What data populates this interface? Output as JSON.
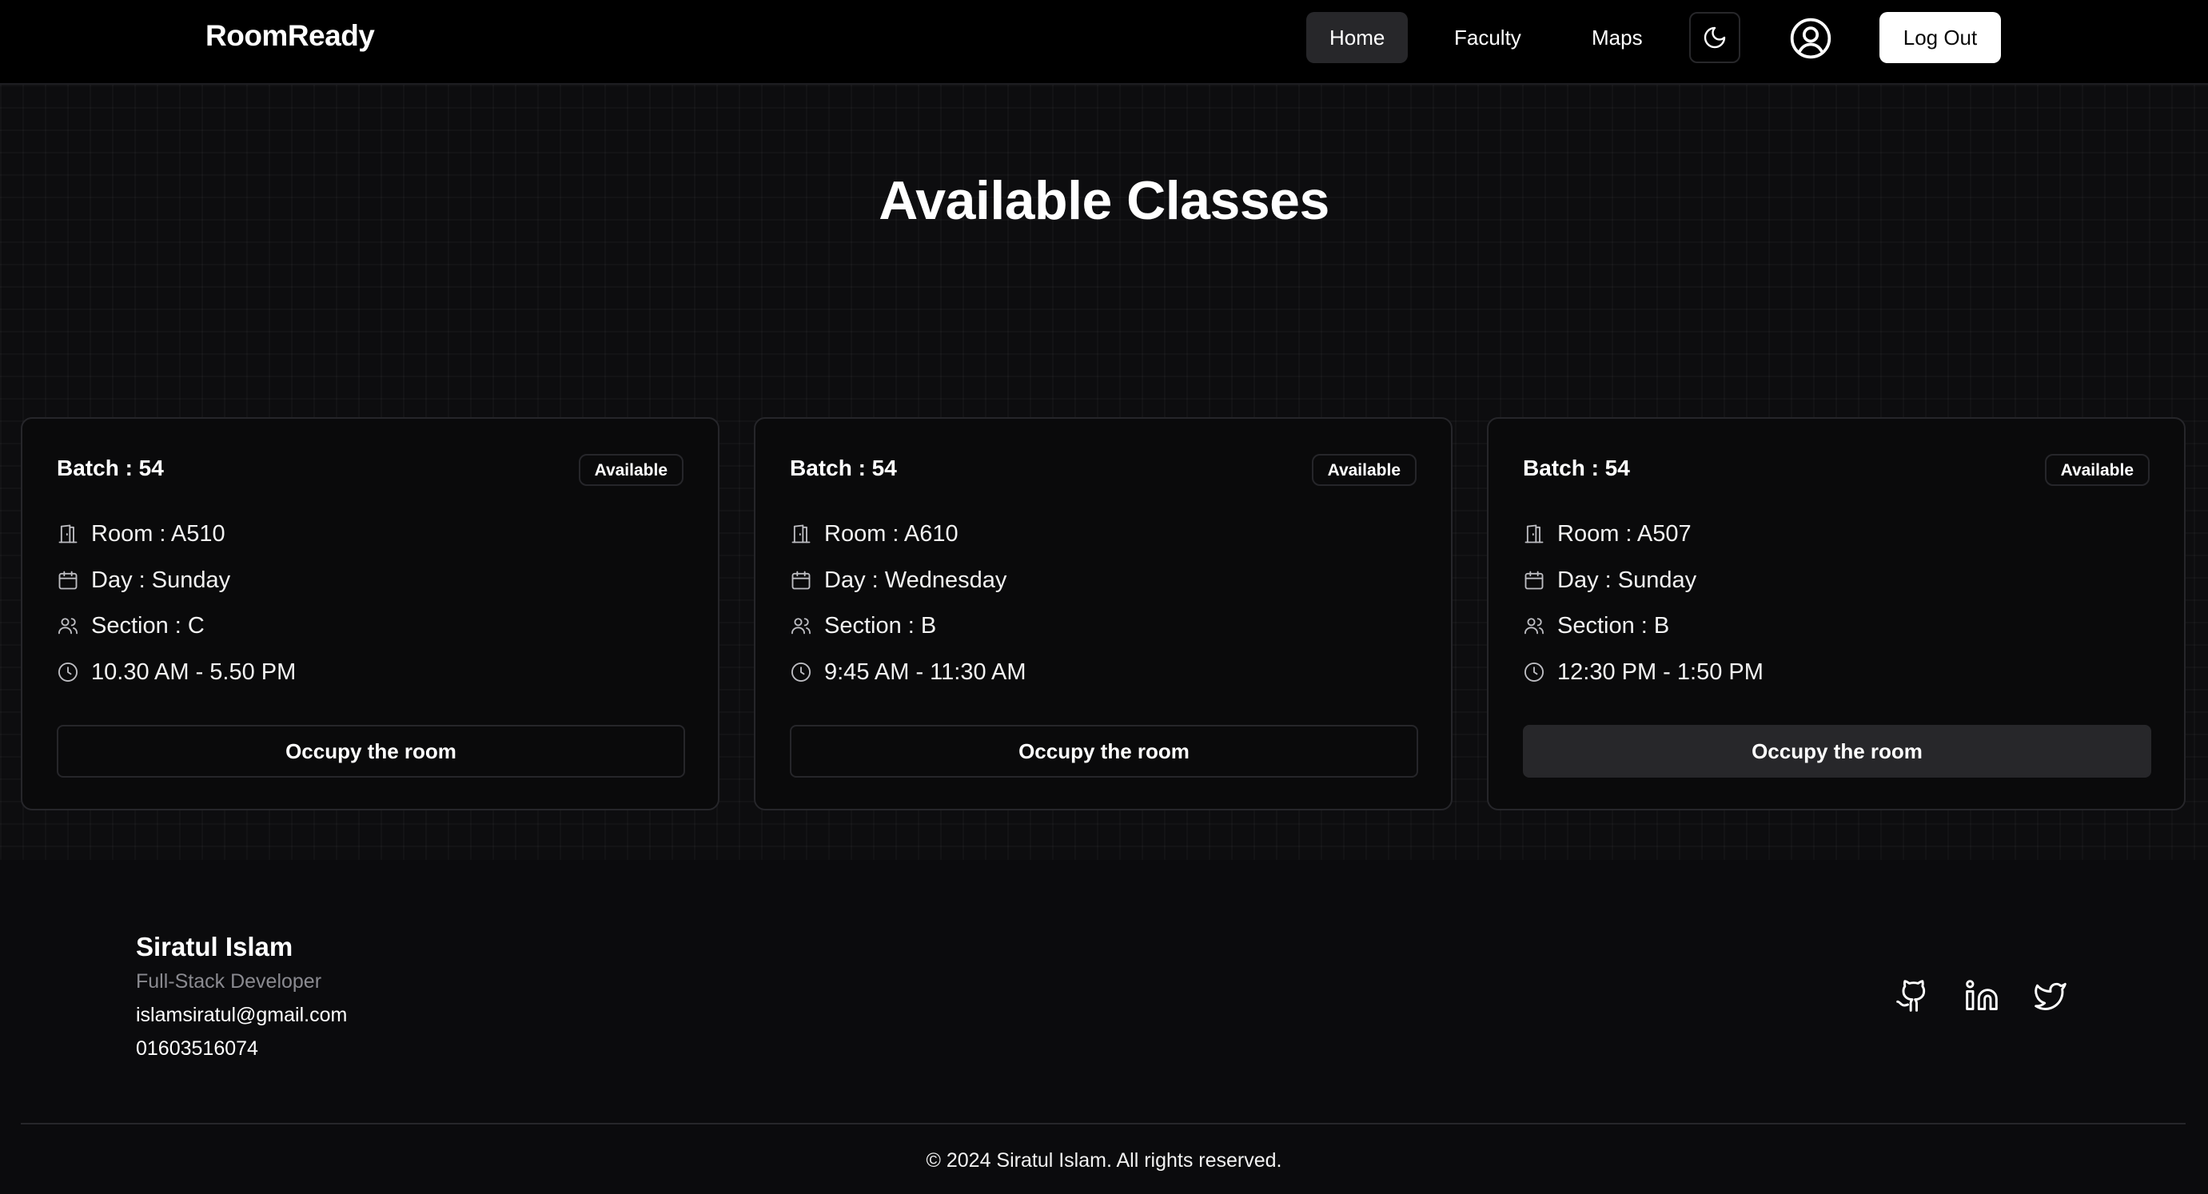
{
  "nav": {
    "brand": "RoomReady",
    "links": [
      {
        "label": "Home",
        "active": true
      },
      {
        "label": "Faculty",
        "active": false
      },
      {
        "label": "Maps",
        "active": false
      }
    ],
    "theme_toggle_icon": "moon-icon",
    "profile_icon": "user-circle-icon",
    "logout_label": "Log Out"
  },
  "page": {
    "title": "Available Classes"
  },
  "cards": [
    {
      "batch": "Batch : 54",
      "status": "Available",
      "room": "Room : A510",
      "day": "Day : Sunday",
      "section": "Section : C",
      "time": "10.30 AM - 5.50 PM",
      "action": "Occupy the room"
    },
    {
      "batch": "Batch : 54",
      "status": "Available",
      "room": "Room : A610",
      "day": "Day : Wednesday",
      "section": "Section : B",
      "time": "9:45 AM - 11:30 AM",
      "action": "Occupy the room"
    },
    {
      "batch": "Batch : 54",
      "status": "Available",
      "room": "Room : A507",
      "day": "Day : Sunday",
      "section": "Section : B",
      "time": "12:30 PM - 1:50 PM",
      "action": "Occupy the room"
    }
  ],
  "footer": {
    "name": "Siratul Islam",
    "role": "Full-Stack Developer",
    "email": "islamsiratul@gmail.com",
    "phone": "01603516074",
    "social_icons": [
      "github-icon",
      "linkedin-icon",
      "twitter-icon"
    ],
    "copyright": "© 2024 Siratul Islam. All rights reserved."
  },
  "colors": {
    "background": "#0b0b0d",
    "nav_background": "#000000",
    "active_nav": "#27272a",
    "border": "#26262a",
    "muted_text": "#8a8a90"
  }
}
